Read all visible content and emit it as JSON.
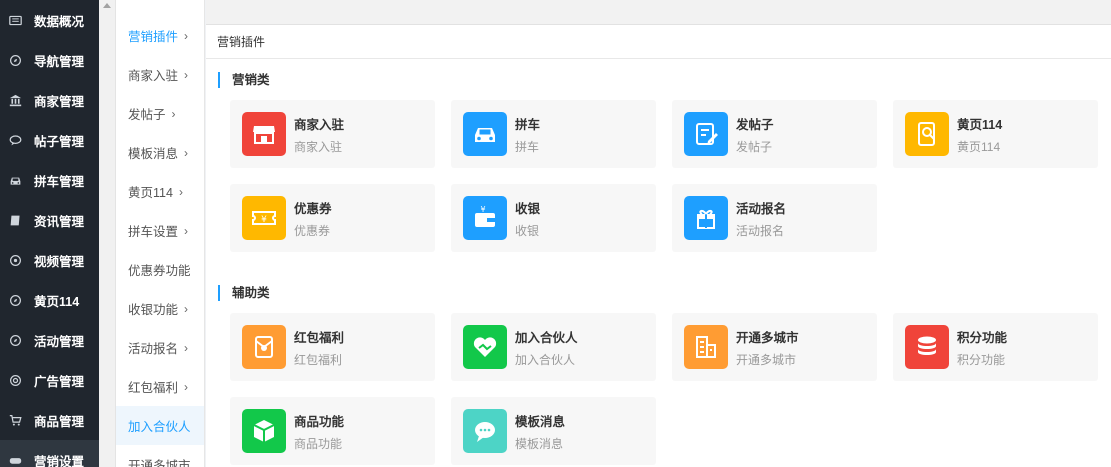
{
  "sidebar": {
    "items": [
      {
        "label": "数据概况",
        "icon": "dashboard-icon"
      },
      {
        "label": "导航管理",
        "icon": "compass-icon"
      },
      {
        "label": "商家管理",
        "icon": "bank-icon"
      },
      {
        "label": "帖子管理",
        "icon": "comment-icon"
      },
      {
        "label": "拼车管理",
        "icon": "car-icon"
      },
      {
        "label": "资讯管理",
        "icon": "book-icon"
      },
      {
        "label": "视频管理",
        "icon": "video-icon"
      },
      {
        "label": "黄页114",
        "icon": "compass-icon"
      },
      {
        "label": "活动管理",
        "icon": "compass-icon"
      },
      {
        "label": "广告管理",
        "icon": "lifebuoy-icon"
      },
      {
        "label": "商品管理",
        "icon": "cart-icon"
      },
      {
        "label": "营销设置",
        "icon": "gamepad-icon"
      }
    ]
  },
  "submenu": {
    "items": [
      {
        "label": "营销插件",
        "arrow": "›"
      },
      {
        "label": "商家入驻",
        "arrow": "›"
      },
      {
        "label": "发帖子",
        "arrow": "›"
      },
      {
        "label": "模板消息",
        "arrow": "›"
      },
      {
        "label": "黄页114",
        "arrow": "›"
      },
      {
        "label": "拼车设置",
        "arrow": "›"
      },
      {
        "label": "优惠券功能",
        "arrow": ""
      },
      {
        "label": "收银功能",
        "arrow": "›"
      },
      {
        "label": "活动报名",
        "arrow": "›"
      },
      {
        "label": "红包福利",
        "arrow": "›"
      },
      {
        "label": "加入合伙人",
        "arrow": ""
      },
      {
        "label": "开通多城市",
        "arrow": ""
      }
    ]
  },
  "breadcrumb": "营销插件",
  "sections": [
    {
      "title": "营销类",
      "cards": [
        {
          "name": "商家入驻",
          "desc": "商家入驻",
          "icon": "store-icon",
          "color": "#f0443a"
        },
        {
          "name": "拼车",
          "desc": "拼车",
          "icon": "car-icon",
          "color": "#1e9fff"
        },
        {
          "name": "发帖子",
          "desc": "发帖子",
          "icon": "edit-post-icon",
          "color": "#1e9fff"
        },
        {
          "name": "黄页114",
          "desc": "黄页114",
          "icon": "phone-search-icon",
          "color": "#ffb800"
        },
        {
          "name": "优惠券",
          "desc": "优惠券",
          "icon": "coupon-icon",
          "color": "#ffb800"
        },
        {
          "name": "收银",
          "desc": "收银",
          "icon": "wallet-icon",
          "color": "#1e9fff"
        },
        {
          "name": "活动报名",
          "desc": "活动报名",
          "icon": "gift-icon",
          "color": "#1e9fff"
        }
      ]
    },
    {
      "title": "辅助类",
      "cards": [
        {
          "name": "红包福利",
          "desc": "红包福利",
          "icon": "red-packet-icon",
          "color": "#ff9c33"
        },
        {
          "name": "加入合伙人",
          "desc": "加入合伙人",
          "icon": "handshake-heart-icon",
          "color": "#12c84a"
        },
        {
          "name": "开通多城市",
          "desc": "开通多城市",
          "icon": "city-buildings-icon",
          "color": "#ff9c33"
        },
        {
          "name": "积分功能",
          "desc": "积分功能",
          "icon": "coins-stack-icon",
          "color": "#f0443a"
        },
        {
          "name": "商品功能",
          "desc": "商品功能",
          "icon": "cube-icon",
          "color": "#12c84a"
        },
        {
          "name": "模板消息",
          "desc": "模板消息",
          "icon": "chat-bubble-icon",
          "color": "#4dd4c6"
        }
      ]
    }
  ]
}
